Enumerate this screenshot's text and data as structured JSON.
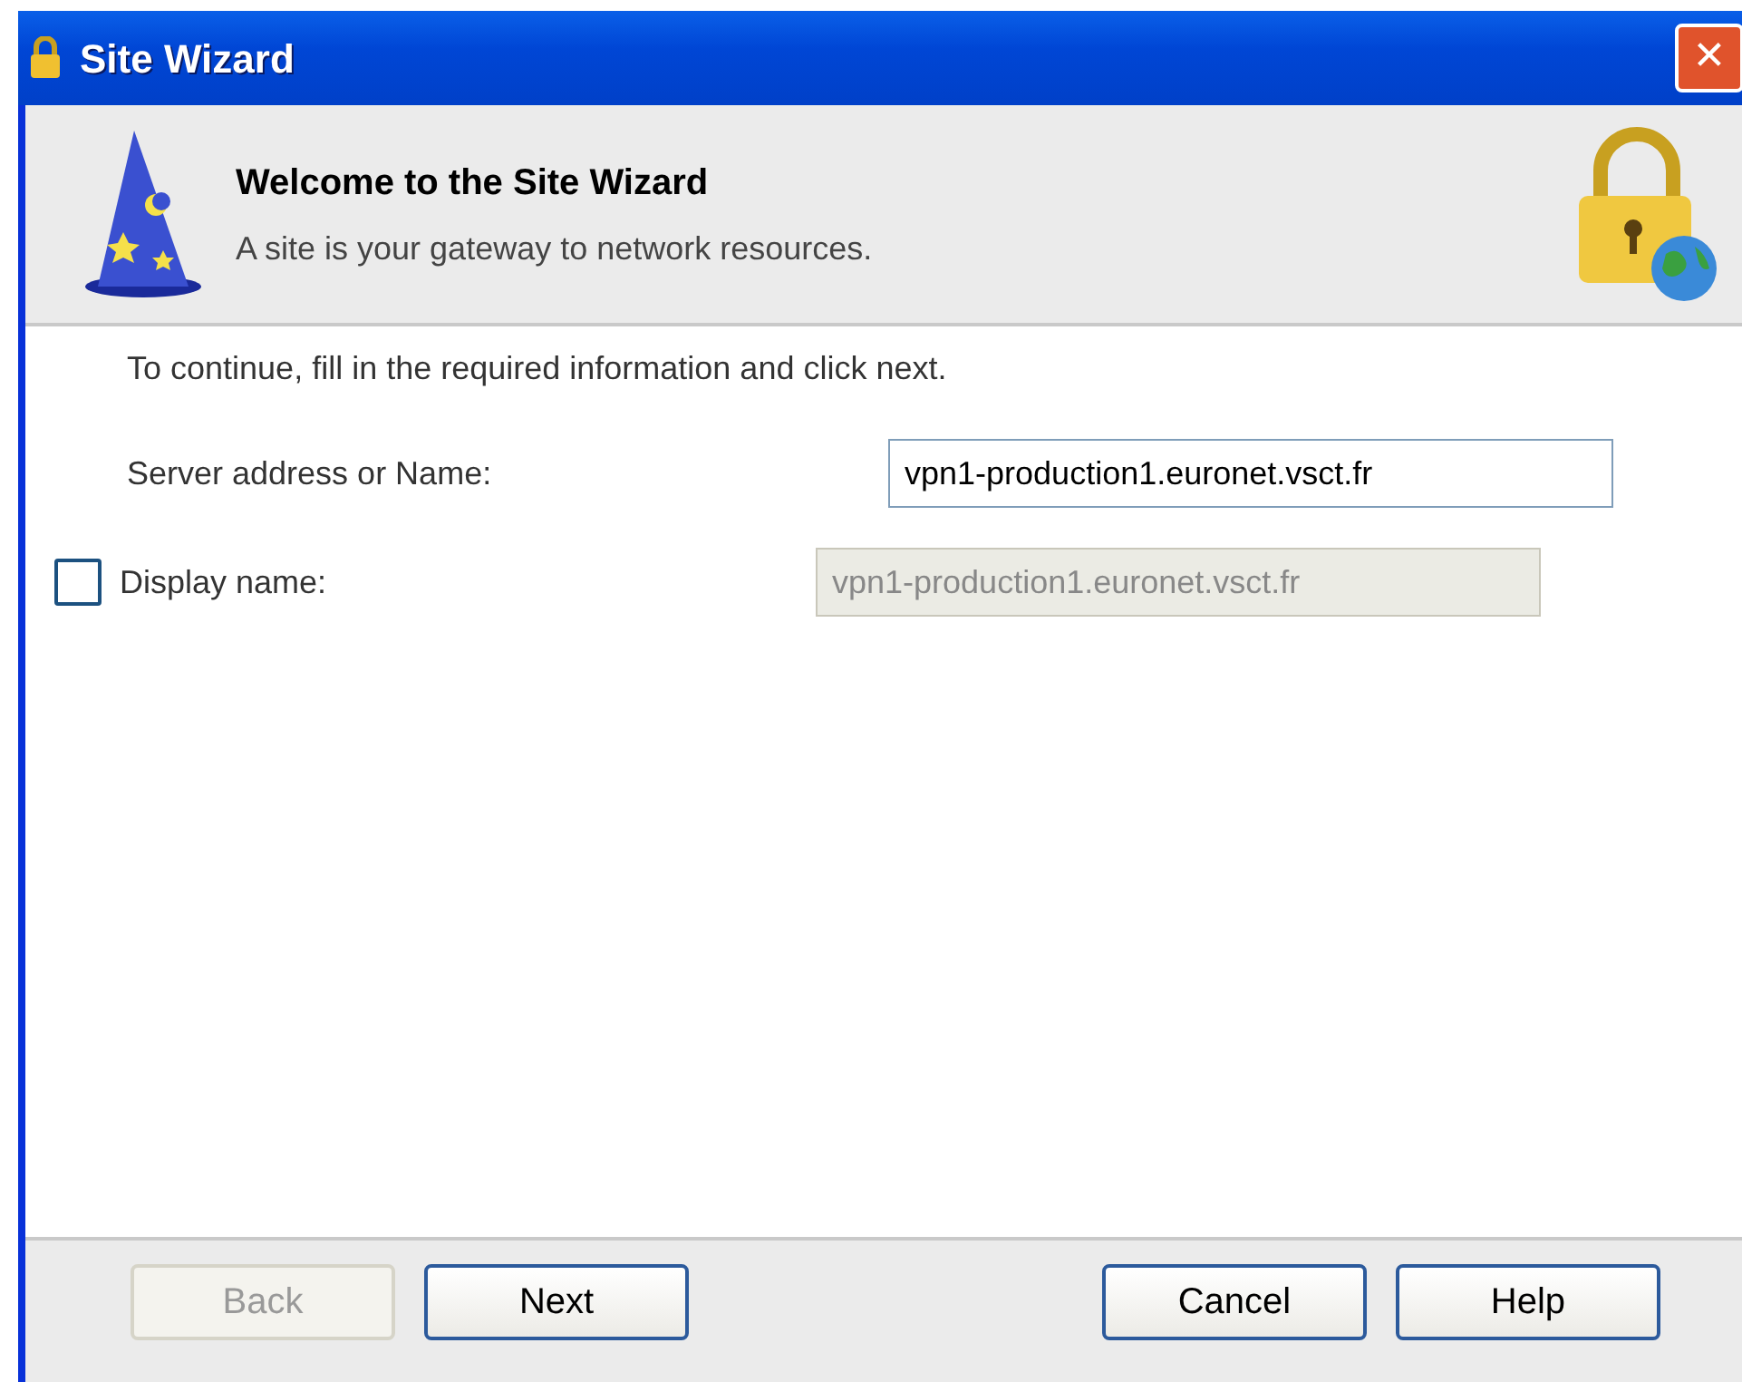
{
  "window": {
    "title": "Site Wizard",
    "close": "✕"
  },
  "header": {
    "title": "Welcome to the Site Wizard",
    "subtitle": "A site is your gateway to network resources."
  },
  "instruction": "To continue, fill in the required information and click next.",
  "fields": [
    {
      "label": "Server address or Name:",
      "value": "vpn1-production1.euronet.vsct.fr",
      "kind": "text",
      "disabled": false
    },
    {
      "label": "Display name:",
      "value": "vpn1-production1.euronet.vsct.fr",
      "kind": "checkbox",
      "checked": false,
      "disabled": true
    }
  ],
  "buttons": [
    {
      "label": "Back",
      "disabled": true
    },
    {
      "label": "Next",
      "disabled": false
    },
    {
      "label": "Cancel",
      "disabled": false
    },
    {
      "label": "Help",
      "disabled": false
    }
  ]
}
